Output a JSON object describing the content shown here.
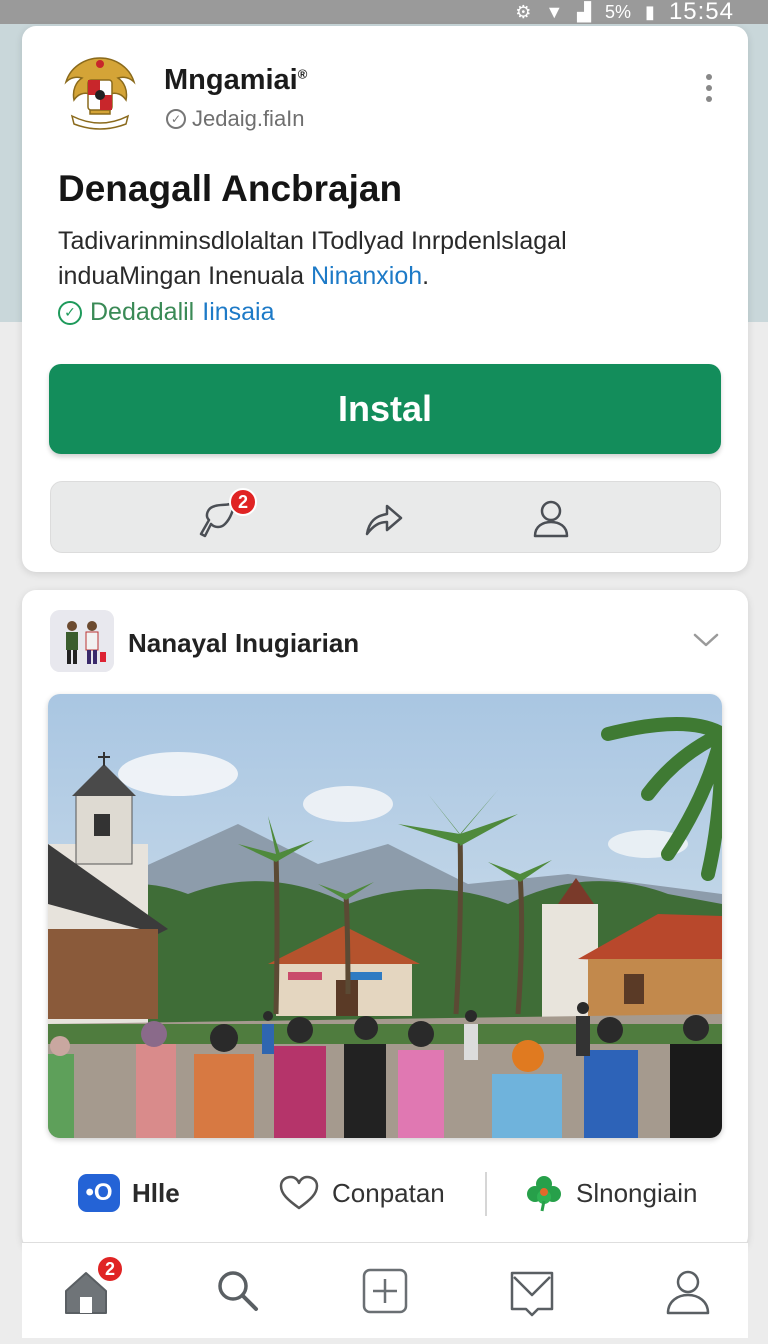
{
  "status_bar": {
    "time": "15:54",
    "battery": "5%"
  },
  "app_card": {
    "name": "Mngamiai",
    "trademark": "®",
    "handle": "Jedaig.fiaIn",
    "title": "Denagall Ancbrajan",
    "description_line1": "Tadivarinminsdlolaltan ITodlyad Inrpdenlslagal",
    "description_line2_prefix": "induaMingan Inenuala ",
    "description_link": "Ninanxioh",
    "description_suffix": ".",
    "verified_part1": "Dedadalil ",
    "verified_part2": "Iinsaia",
    "install_label": "Instal",
    "notification_count": "2"
  },
  "post_card": {
    "title": "Nanayal Inugiarian",
    "actions": {
      "chat_icon_text": "•O",
      "chat_label": "Hlle",
      "like_label": "Conpatan",
      "share_label": "Slnongiain"
    }
  },
  "bottom_nav": {
    "home_badge": "2"
  },
  "colors": {
    "install": "#138d5b",
    "link": "#1d7ac7",
    "verified": "#1e9a5b",
    "badge": "#e02424",
    "chat": "#2463d6"
  }
}
